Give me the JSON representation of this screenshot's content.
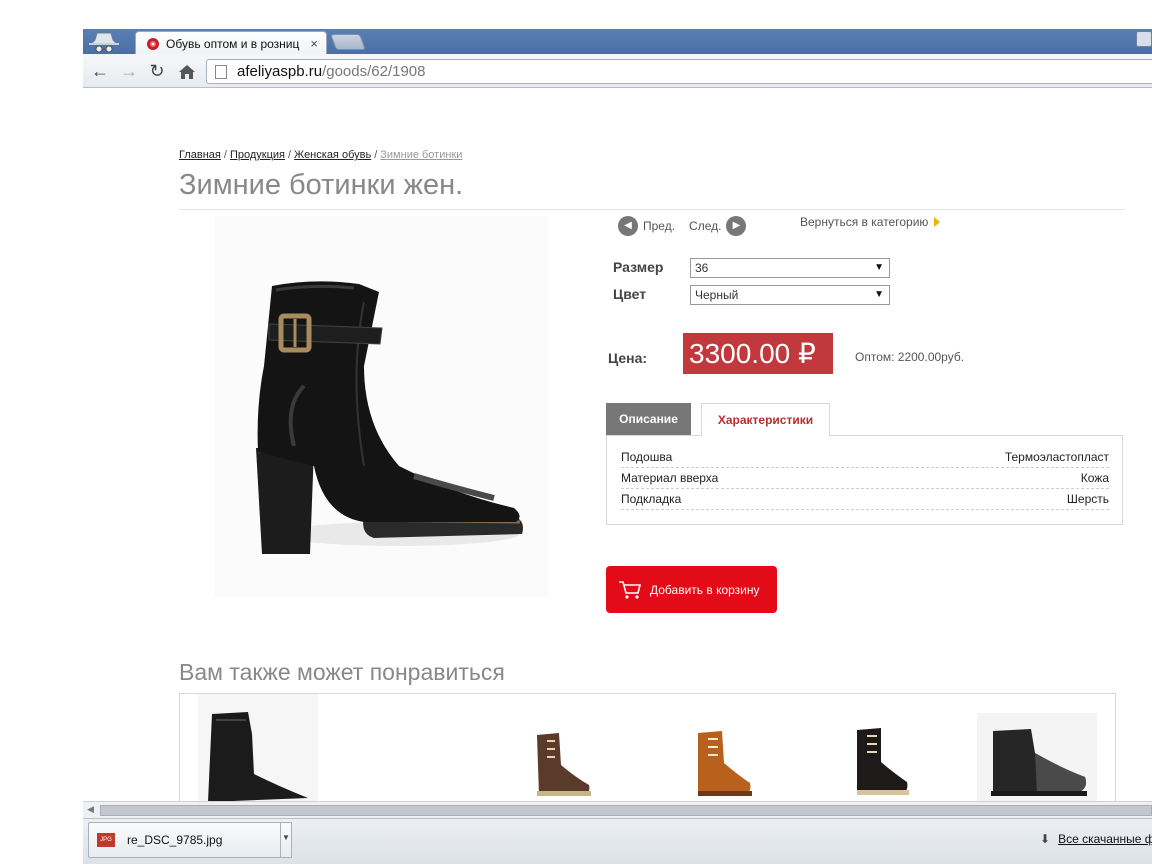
{
  "browser": {
    "tab_title": "Обувь оптом и в розниц",
    "tab_close": "×",
    "url_host": "afeliyaspb.ru",
    "url_path": "/goods/62/1908",
    "nav_icons": [
      "back-icon",
      "forward-icon",
      "reload-icon",
      "home-icon"
    ]
  },
  "breadcrumb": {
    "items": [
      "Главная",
      "Продукция",
      "Женская обувь"
    ],
    "current": "Зимние ботинки",
    "separator": "/"
  },
  "page_title": "Зимние ботинки жен.",
  "pager": {
    "prev": "Пред.",
    "next": "След.",
    "back_to_category": "Вернуться в категорию"
  },
  "options": {
    "size_label": "Размер",
    "size_value": "36",
    "color_label": "Цвет",
    "color_value": "Черный"
  },
  "price": {
    "label": "Цена:",
    "value": "3300.00 ₽",
    "wholesale": "Оптом: 2200.00руб.",
    "accent_color": "#c1393c"
  },
  "tabs": {
    "description": "Описание",
    "characteristics": "Характеристики"
  },
  "specs": [
    {
      "key": "Подошва",
      "value": "Термоэластопласт"
    },
    {
      "key": "Материал вверха",
      "value": "Кожа"
    },
    {
      "key": "Подкладка",
      "value": "Шерсть"
    }
  ],
  "cart_button": {
    "label": "Добавить в корзину",
    "color": "#e30b17"
  },
  "related": {
    "title": "Вам также может понравиться"
  },
  "downloads": {
    "file": "re_DSC_9785.jpg",
    "file_type": "JPG",
    "show_all": "Все скачанные ф"
  }
}
